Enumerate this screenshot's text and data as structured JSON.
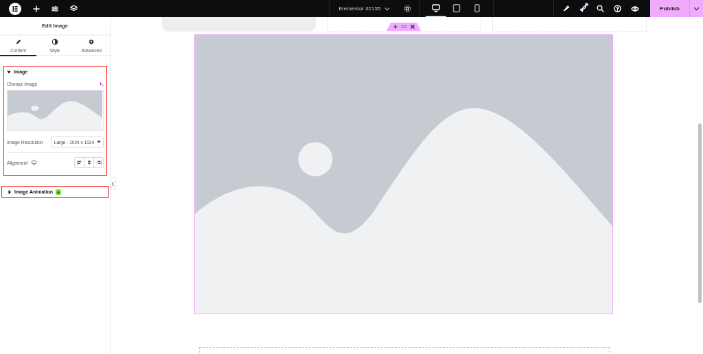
{
  "topbar": {
    "document_title": "Elementor #2155",
    "device_tabs": [
      {
        "kind": "desktop",
        "selected": true
      },
      {
        "kind": "tablet",
        "selected": false
      },
      {
        "kind": "mobile",
        "selected": false
      }
    ],
    "notification_dot": true,
    "publish_label": "Publish"
  },
  "panel": {
    "title": "Edit Image",
    "tabs": [
      {
        "kind": "content",
        "label": "Content",
        "selected": true
      },
      {
        "kind": "style",
        "label": "Style",
        "selected": false
      },
      {
        "kind": "advanced",
        "label": "Advanced",
        "selected": false
      }
    ],
    "sections": [
      {
        "title": "Image",
        "expanded": true,
        "highlighted": true,
        "pro": false,
        "controls": [
          {
            "kind": "media",
            "label": "Choose Image"
          },
          {
            "kind": "select",
            "label": "Image Resolution",
            "value": "Large - 1024 x 1024"
          },
          {
            "kind": "alignment",
            "label": "Alignment"
          }
        ]
      },
      {
        "title": "Image Animation",
        "expanded": false,
        "highlighted": true,
        "pro": true
      }
    ]
  }
}
